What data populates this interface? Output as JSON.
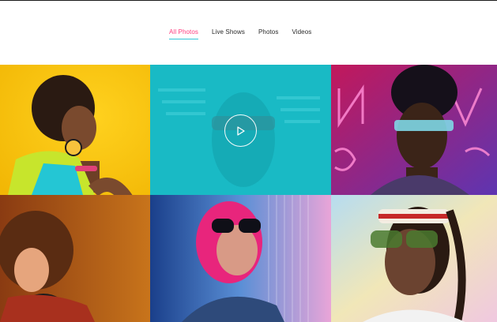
{
  "filter_tabs": [
    {
      "label": "All Photos",
      "active": true
    },
    {
      "label": "Live Shows",
      "active": false
    },
    {
      "label": "Photos",
      "active": false
    },
    {
      "label": "Videos",
      "active": false
    }
  ],
  "colors": {
    "active_tab_text": "#ff3d7f",
    "active_tab_underline": "#36c4d9",
    "tab_text": "#2a2a2a",
    "video_overlay": "#14bec8"
  },
  "gallery": {
    "tiles": [
      {
        "kind": "photo",
        "background": "yellow"
      },
      {
        "kind": "video",
        "background": "teal",
        "icon": "play-icon"
      },
      {
        "kind": "photo",
        "background": "neon-pink"
      },
      {
        "kind": "photo",
        "background": "warm-orange"
      },
      {
        "kind": "photo",
        "background": "neon-blue-pink"
      },
      {
        "kind": "photo",
        "background": "pastel"
      }
    ]
  }
}
